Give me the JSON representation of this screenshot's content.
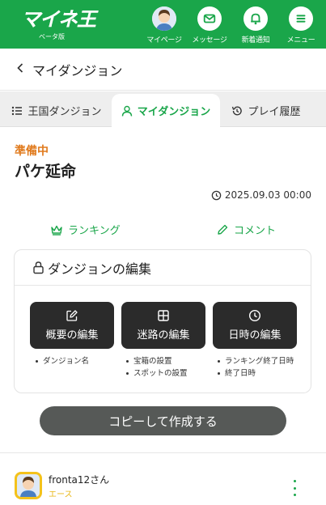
{
  "header": {
    "logo": "マイネ王",
    "logo_sub": "ベータ版",
    "nav": [
      {
        "label": "マイページ",
        "icon": "avatar-icon"
      },
      {
        "label": "メッセージ",
        "icon": "mail-icon"
      },
      {
        "label": "新着通知",
        "icon": "bell-icon"
      },
      {
        "label": "メニュー",
        "icon": "menu-icon"
      }
    ]
  },
  "page": {
    "back_title": "マイダンジョン"
  },
  "tabs": [
    {
      "label": "王国ダンジョン",
      "icon": "list-icon"
    },
    {
      "label": "マイダンジョン",
      "icon": "user-icon",
      "active": true
    },
    {
      "label": "プレイ履歴",
      "icon": "history-icon"
    }
  ],
  "dungeon": {
    "status": "準備中",
    "name": "パケ延命",
    "datetime": "2025.09.03 00:00"
  },
  "links": {
    "ranking": "ランキング",
    "comment": "コメント"
  },
  "edit": {
    "title": "ダンジョンの編集",
    "buttons": [
      {
        "label": "概要の編集",
        "bullets": [
          "ダンジョン名"
        ]
      },
      {
        "label": "迷路の編集",
        "bullets": [
          "宝箱の設置",
          "スポットの設置"
        ]
      },
      {
        "label": "日時の編集",
        "bullets": [
          "ランキング終了日時",
          "終了日時"
        ]
      }
    ]
  },
  "copy_button": "コピーして作成する",
  "user": {
    "name": "fronta12さん",
    "rank": "エース"
  },
  "colors": {
    "brand": "#1aa64a",
    "status": "#e07a1d",
    "rank": "#e8b716"
  }
}
